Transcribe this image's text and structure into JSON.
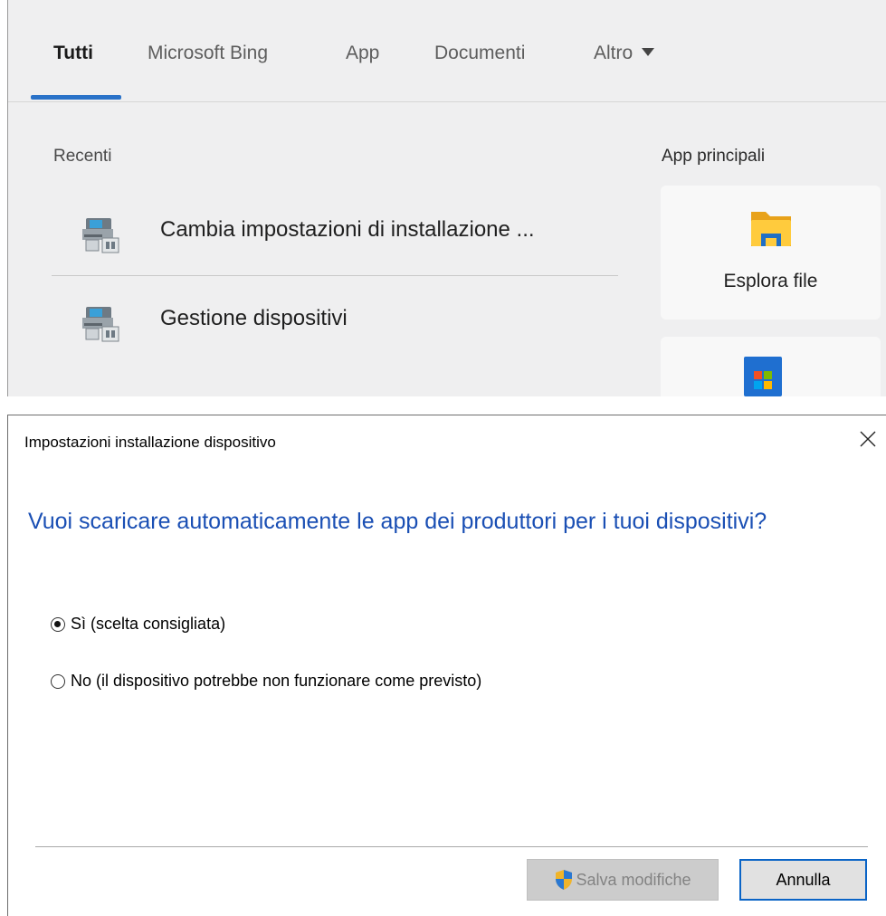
{
  "search_panel": {
    "tabs": [
      {
        "label": "Tutti",
        "active": true
      },
      {
        "label": "Microsoft Bing",
        "active": false
      },
      {
        "label": "App",
        "active": false
      },
      {
        "label": "Documenti",
        "active": false
      },
      {
        "label": "Altro",
        "active": false
      }
    ],
    "recent": {
      "title": "Recenti",
      "items": [
        {
          "label": "Cambia impostazioni di installazione ...",
          "icon": "device-setup-icon"
        },
        {
          "label": "Gestione dispositivi",
          "icon": "device-manager-icon"
        }
      ]
    },
    "top_apps": {
      "title": "App principali",
      "items": [
        {
          "label": "Esplora file",
          "icon": "file-explorer-icon"
        },
        {
          "label": "",
          "icon": "microsoft-store-icon"
        }
      ]
    },
    "accent_color": "#2a72c8"
  },
  "dialog": {
    "title": "Impostazioni installazione dispositivo",
    "question": "Vuoi scaricare automaticamente le app dei produttori per i tuoi dispositivi?",
    "options": [
      {
        "label": "Sì (scelta consigliata)",
        "selected": true
      },
      {
        "label": "No (il dispositivo potrebbe non funzionare come previsto)",
        "selected": false
      }
    ],
    "buttons": {
      "save": "Salva modifiche",
      "cancel": "Annulla"
    },
    "question_color": "#1a4fb4"
  }
}
